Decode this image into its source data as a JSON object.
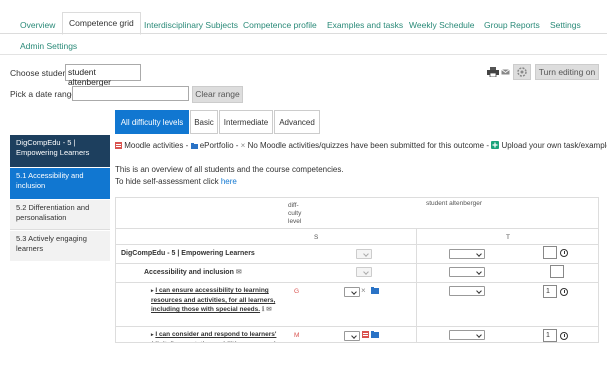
{
  "nav": {
    "tabs": [
      {
        "label": "Overview"
      },
      {
        "label": "Competence grid"
      },
      {
        "label": "Interdisciplinary Subjects"
      },
      {
        "label": "Competence profile"
      },
      {
        "label": "Examples and tasks"
      },
      {
        "label": "Weekly Schedule"
      },
      {
        "label": "Group Reports"
      },
      {
        "label": "Settings"
      },
      {
        "label": "Admin Settings"
      }
    ]
  },
  "controls": {
    "choose_student_label": "Choose student:",
    "student_value": "student altenberger",
    "date_range_label": "Pick a date range:",
    "clear_range": "Clear range",
    "turn_editing_on": "Turn editing on"
  },
  "sidebar": {
    "items": [
      {
        "label": "DigCompEdu - 5 | Empowering Learners"
      },
      {
        "label": "5.1 Accessibility and inclusion"
      },
      {
        "label": "5.2 Differentiation and personalisation"
      },
      {
        "label": "5.3 Actively engaging learners"
      }
    ]
  },
  "difficulty_tabs": [
    {
      "label": "All difficulty levels"
    },
    {
      "label": "Basic"
    },
    {
      "label": "Intermediate"
    },
    {
      "label": "Advanced"
    }
  ],
  "legend": {
    "moodle_activities": "Moodle activities -",
    "eportfolio": "ePortfolio -",
    "no_moodle": "No Moodle activities/quizzes have been submitted for this outcome -",
    "upload": "Upload your own task/example"
  },
  "overview_text": "This is an overview of all students and the course competencies.",
  "hide_text": "To hide self-assessment click",
  "hide_link": "here",
  "grid": {
    "difficulty_header": "diff-culty level",
    "student_header": "student altenberger",
    "col_s": "S",
    "col_t": "T",
    "rows": [
      {
        "title": "DigCompEdu - 5 | Empowering Learners",
        "level": "",
        "score": ""
      },
      {
        "title": "Accessibility and inclusion",
        "level": "",
        "score": ""
      },
      {
        "title": "I can ensure accessibility to learning resources and activities, for all learners, including those with special needs.",
        "level": "G",
        "score": "1"
      },
      {
        "title": "I can consider and respond to learners' (digital) expectations, abilities, uses and",
        "level": "M",
        "score": "1"
      }
    ]
  },
  "colors": {
    "accent": "#1177d1",
    "link": "#2a8a78",
    "danger": "#d9534f"
  },
  "icons": [
    "print-icon",
    "mail-icon",
    "settings-icon",
    "clock-icon",
    "folder-icon",
    "comment-icon"
  ]
}
